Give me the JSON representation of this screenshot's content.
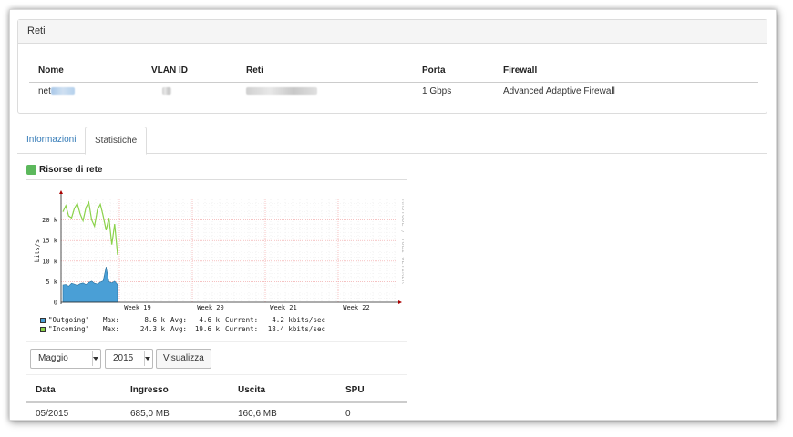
{
  "networks_panel": {
    "title": "Reti",
    "columns": [
      "Nome",
      "VLAN ID",
      "Reti",
      "Porta",
      "Firewall"
    ],
    "row": {
      "name_prefix": "net",
      "port": "1 Gbps",
      "firewall": "Advanced Adaptive Firewall"
    }
  },
  "tabs": [
    {
      "label": "Informazioni"
    },
    {
      "label": "Statistiche"
    }
  ],
  "section": {
    "title": "Risorse di rete",
    "accent_color": "#5cb85c"
  },
  "chart_data": {
    "type": "area",
    "ylabel": "bits/s",
    "watermark": "RRDTOOL / TOBI OETIKER",
    "y_ticks": [
      "0",
      "5 k",
      "10 k",
      "15 k",
      "20 k"
    ],
    "ylim": [
      0,
      25000
    ],
    "x_ticks": [
      "Week 19",
      "Week 20",
      "Week 21",
      "Week 22"
    ],
    "series": [
      {
        "name": "\"Outgoing\"",
        "color": "#4a9fd6",
        "values": [
          4200,
          4300,
          3900,
          4600,
          4400,
          4100,
          4500,
          4700,
          4300,
          4800,
          5100,
          4600,
          4400,
          4900,
          5200,
          8600,
          5000,
          4700,
          5100,
          4300
        ]
      },
      {
        "name": "\"Incoming\"",
        "color": "#8bd24a",
        "values": [
          22000,
          23500,
          21000,
          20500,
          22800,
          24000,
          21500,
          19800,
          23000,
          24300,
          20000,
          18500,
          22500,
          23800,
          21000,
          17500,
          20500,
          14000,
          19000,
          11500
        ]
      }
    ],
    "legend": [
      {
        "name": "\"Outgoing\"",
        "max": "8.6 k",
        "avg": "4.6 k",
        "current": "4.2 kbits/sec"
      },
      {
        "name": "\"Incoming\"",
        "max": "24.3 k",
        "avg": "19.6 k",
        "current": "18.4 kbits/sec"
      }
    ],
    "legend_labels": {
      "max": "Max:",
      "avg": "Avg:",
      "current": "Current:"
    }
  },
  "controls": {
    "month": "Maggio",
    "year": "2015",
    "view_button": "Visualizza"
  },
  "stats_table": {
    "columns": [
      "Data",
      "Ingresso",
      "Uscita",
      "SPU"
    ],
    "rows": [
      {
        "date": "05/2015",
        "in": "685,0 MB",
        "out": "160,6 MB",
        "spu": "0"
      }
    ]
  }
}
